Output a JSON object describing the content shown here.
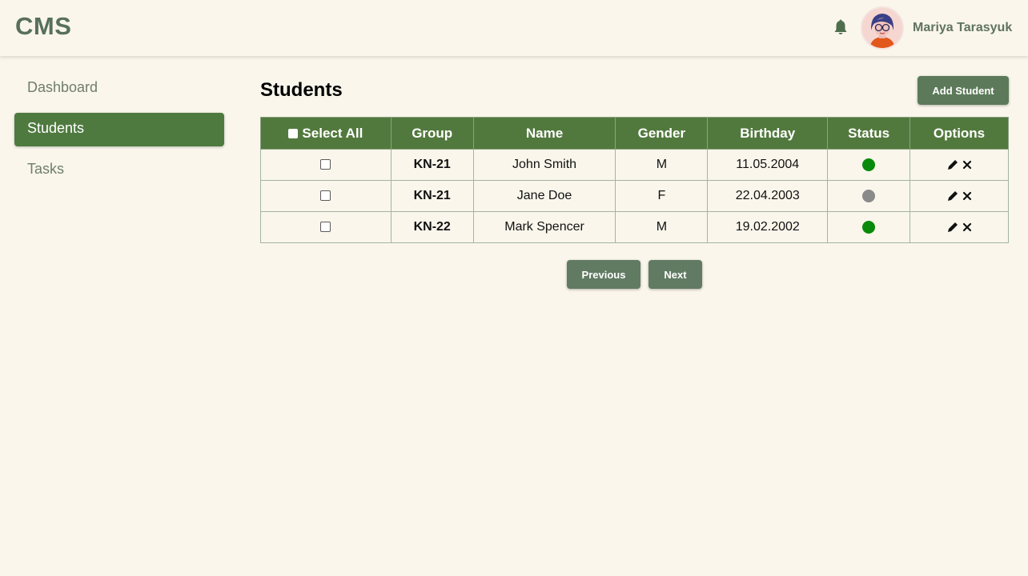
{
  "app": {
    "brand": "CMS"
  },
  "user": {
    "name": "Mariya Tarasyuk"
  },
  "sidebar": {
    "items": [
      {
        "label": "Dashboard",
        "active": false
      },
      {
        "label": "Students",
        "active": true
      },
      {
        "label": "Tasks",
        "active": false
      }
    ]
  },
  "main": {
    "title": "Students",
    "add_button": "Add Student",
    "table": {
      "select_all_label": "Select All",
      "columns": [
        "Group",
        "Name",
        "Gender",
        "Birthday",
        "Status",
        "Options"
      ],
      "rows": [
        {
          "group": "KN-21",
          "name": "John Smith",
          "gender": "M",
          "birthday": "11.05.2004",
          "status": "active"
        },
        {
          "group": "KN-21",
          "name": "Jane Doe",
          "gender": "F",
          "birthday": "22.04.2003",
          "status": "inactive"
        },
        {
          "group": "KN-22",
          "name": "Mark Spencer",
          "gender": "M",
          "birthday": "19.02.2002",
          "status": "active"
        }
      ]
    },
    "pagination": {
      "previous": "Previous",
      "next": "Next"
    }
  },
  "colors": {
    "accent": "#52793d",
    "status_active": "#0a8a0a",
    "status_inactive": "#8a8a8a",
    "background": "#faf6ec"
  },
  "icons": [
    "bell-icon",
    "avatar",
    "pencil-icon",
    "close-icon"
  ]
}
